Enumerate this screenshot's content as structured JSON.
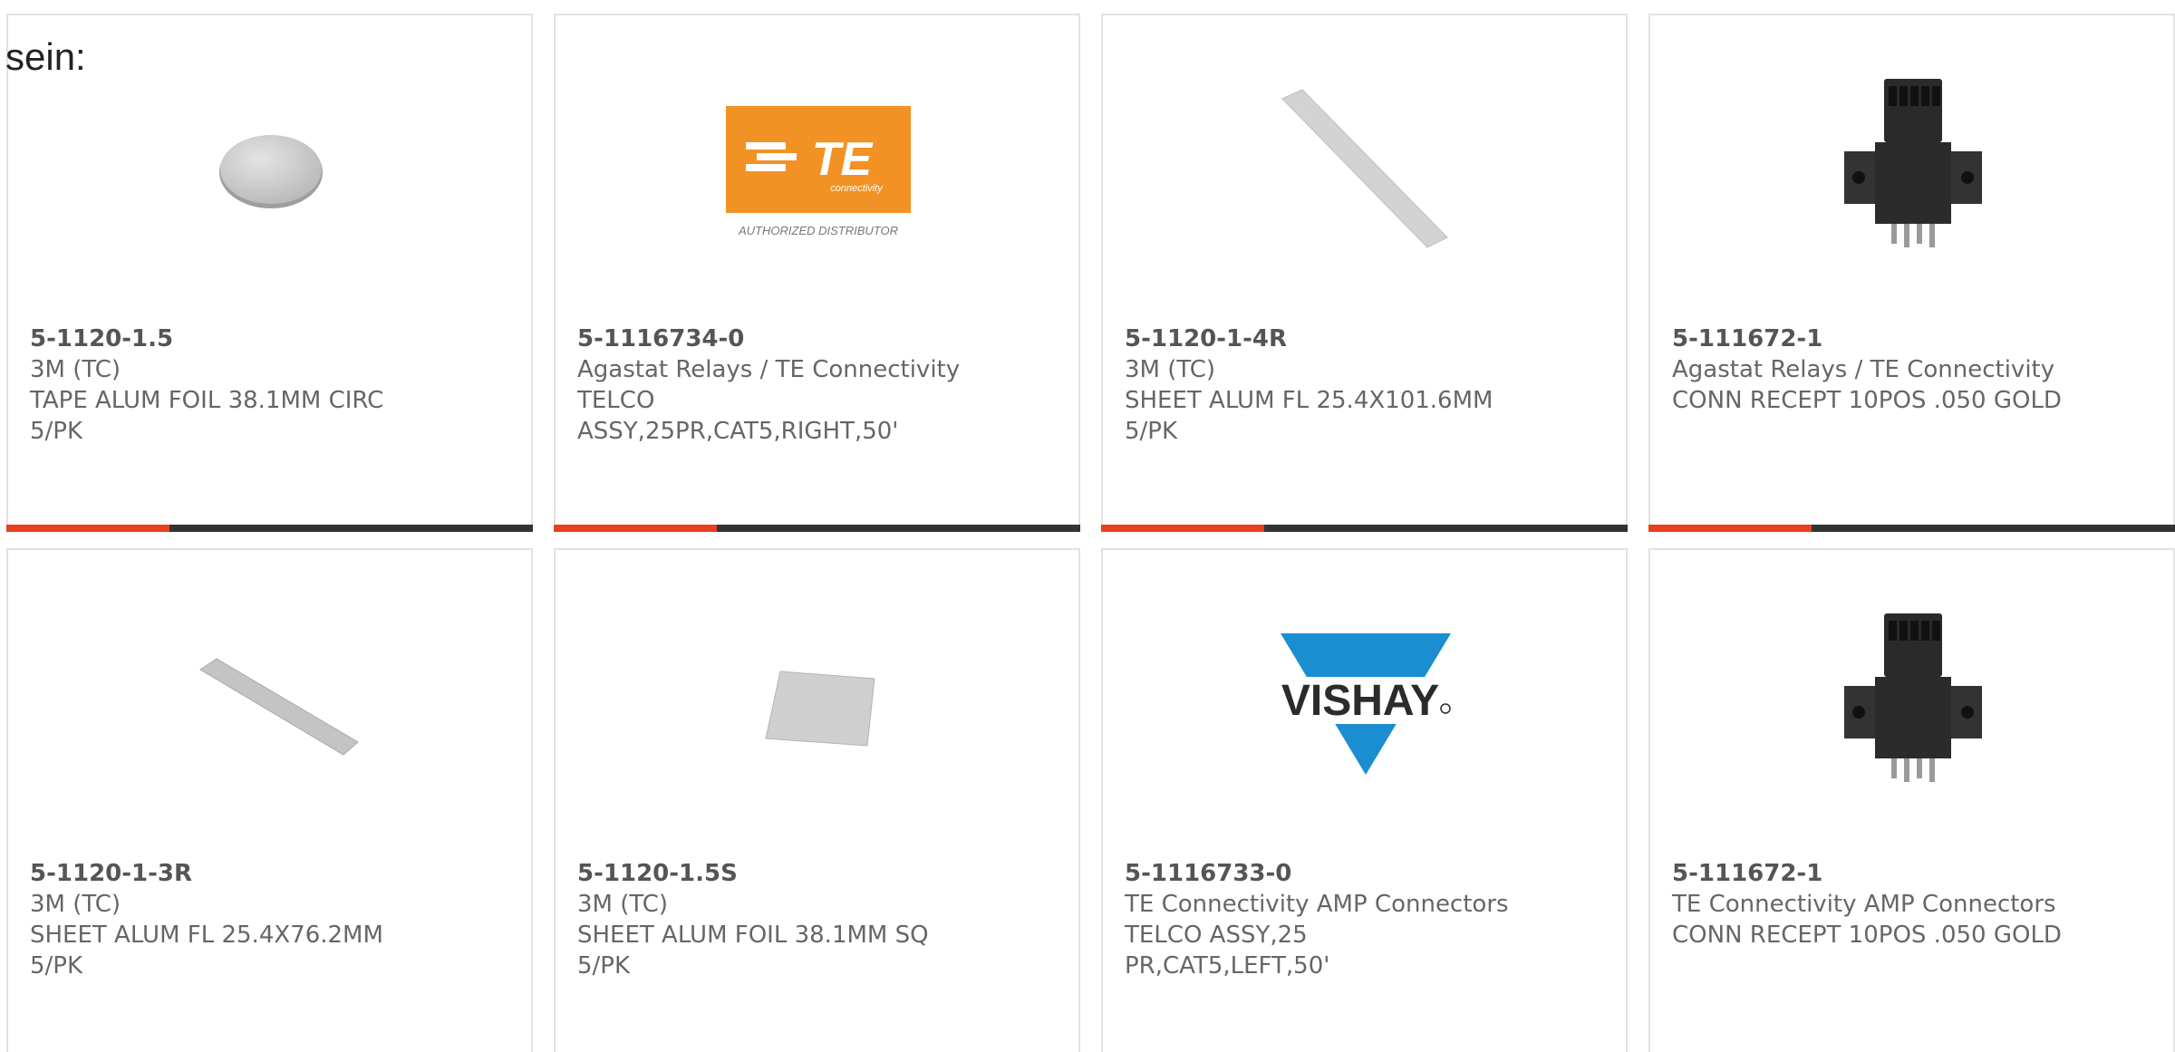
{
  "header": {
    "text": "sein:"
  },
  "products": [
    {
      "part_number": "5-1120-1.5",
      "manufacturer": "3M (TC)",
      "description_lines": [
        "TAPE ALUM FOIL 38.1MM CIRC",
        "5/PK"
      ],
      "image": "circular-foil-disc",
      "progress": 0.31
    },
    {
      "part_number": "5-1116734-0",
      "manufacturer": "Agastat Relays / TE Connectivity",
      "description_lines": [
        "TELCO",
        "ASSY,25PR,CAT5,RIGHT,50'"
      ],
      "image": "te-connectivity-logo",
      "logo": {
        "mark": "TE",
        "sub": "connectivity",
        "tagline": "AUTHORIZED DISTRIBUTOR",
        "color": "#f39224"
      },
      "progress": 0.31
    },
    {
      "part_number": "5-1120-1-4R",
      "manufacturer": "3M (TC)",
      "description_lines": [
        "SHEET ALUM FL 25.4X101.6MM",
        "5/PK"
      ],
      "image": "long-foil-strip",
      "progress": 0.31
    },
    {
      "part_number": "5-111672-1",
      "manufacturer": "Agastat Relays / TE Connectivity",
      "description_lines": [
        "CONN RECEPT 10POS .050 GOLD"
      ],
      "image": "black-connector",
      "progress": 0.31
    },
    {
      "part_number": "5-1120-1-3R",
      "manufacturer": "3M (TC)",
      "description_lines": [
        "SHEET ALUM FL 25.4X76.2MM",
        "5/PK"
      ],
      "image": "short-foil-strip",
      "progress": 0
    },
    {
      "part_number": "5-1120-1.5S",
      "manufacturer": "3M (TC)",
      "description_lines": [
        "SHEET ALUM FOIL 38.1MM SQ",
        "5/PK"
      ],
      "image": "square-foil-sheet",
      "progress": 0
    },
    {
      "part_number": "5-1116733-0",
      "manufacturer": "TE Connectivity AMP Connectors",
      "description_lines": [
        "TELCO ASSY,25",
        "PR,CAT5,LEFT,50'"
      ],
      "image": "vishay-logo",
      "logo": {
        "mark": "VISHAY",
        "color": "#1a8ed0"
      },
      "progress": 0
    },
    {
      "part_number": "5-111672-1",
      "manufacturer": "TE Connectivity AMP Connectors",
      "description_lines": [
        "CONN RECEPT 10POS .050 GOLD"
      ],
      "image": "black-connector",
      "progress": 0
    }
  ],
  "colors": {
    "progress_fill": "#e8401c",
    "progress_track": "#333333",
    "card_border": "#e2e2e2",
    "text": "#666666"
  }
}
